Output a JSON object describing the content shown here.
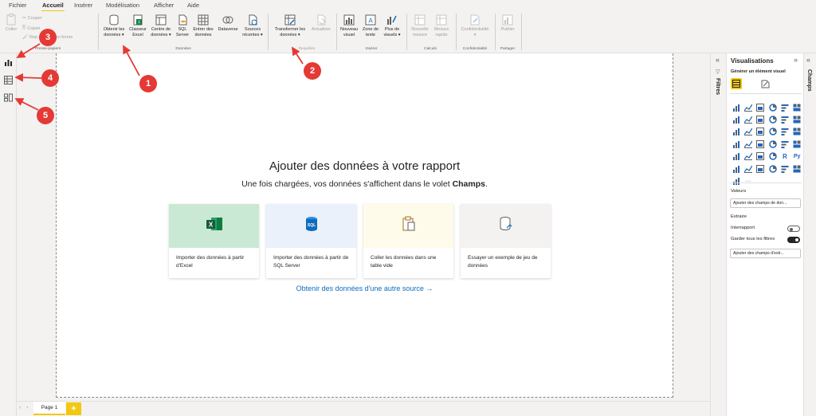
{
  "menu": {
    "tabs": [
      "Fichier",
      "Accueil",
      "Insérer",
      "Modélisation",
      "Afficher",
      "Aide"
    ],
    "active_tab": "Accueil"
  },
  "ribbon": {
    "clipboard": {
      "paste": "Coller",
      "cut": "Couper",
      "copy": "Copier",
      "format_painter_a": "Rep",
      "format_painter_b": "ise en forme",
      "group": "Presse-papiers"
    },
    "data": {
      "get_data": [
        "Obtenir les",
        "données"
      ],
      "excel": [
        "Classeur",
        "Excel"
      ],
      "datahub": [
        "Centre de",
        "données"
      ],
      "sql": [
        "SQL",
        "Server"
      ],
      "enter": [
        "Entrer des",
        "données"
      ],
      "dataverse": "Dataverse",
      "recent": [
        "Sources",
        "récentes"
      ],
      "group": "Données"
    },
    "queries": {
      "transform": [
        "Transformer les",
        "données"
      ],
      "refresh": "Actualiser",
      "group": "Requêtes"
    },
    "insert": {
      "new_visual": [
        "Nouveau",
        "visuel"
      ],
      "text_box": [
        "Zone de",
        "texte"
      ],
      "more_visuals": [
        "Plus de",
        "visuels"
      ],
      "group": "Insérer"
    },
    "calc": {
      "new_measure": [
        "Nouvelle",
        "mesure"
      ],
      "quick_measure": [
        "Mesure",
        "rapide"
      ],
      "group": "Calculs"
    },
    "sensitivity": {
      "label": "Confidentialité",
      "group": "Confidentialité"
    },
    "share": {
      "publish": "Publier",
      "group": "Partager"
    }
  },
  "canvas": {
    "title": "Ajouter des données à votre rapport",
    "subtitle_prefix": "Une fois chargées, vos données s'affichent dans le volet ",
    "subtitle_bold": "Champs",
    "subtitle_suffix": ".",
    "cards": [
      {
        "label": "Importer des données à partir d'Excel",
        "color": "#c9e9d5",
        "icon": "excel-icon"
      },
      {
        "label": "Importer des données à partir de SQL Server",
        "color": "#eaf1fb",
        "icon": "sql-icon"
      },
      {
        "label": "Coller les données dans une table vide",
        "color": "#fffbea",
        "icon": "paste-icon"
      },
      {
        "label": "Essayer un exemple de jeu de données",
        "color": "#f3f2f1",
        "icon": "sample-data-icon"
      }
    ],
    "other_source": "Obtenir des données d'une autre source →"
  },
  "pages": {
    "tabs": [
      "Page 1"
    ],
    "add": "+"
  },
  "filters_label": "Filtres",
  "viz": {
    "title": "Visualisations",
    "subtitle": "Générer un élément visuel",
    "values_label": "Valeurs",
    "values_placeholder": "Ajouter des champs de don...",
    "drillthrough_label": "Extraire",
    "cross_report": "Interrapport",
    "keep_filters": "Garder tous les filtres",
    "drill_placeholder": "Ajouter des champs d'extr..."
  },
  "fields_label": "Champs",
  "annotations": [
    "1",
    "2",
    "3",
    "4",
    "5"
  ],
  "colors": {
    "accent": "#f2c811",
    "link": "#0f6cbd",
    "badge": "#e53935"
  }
}
